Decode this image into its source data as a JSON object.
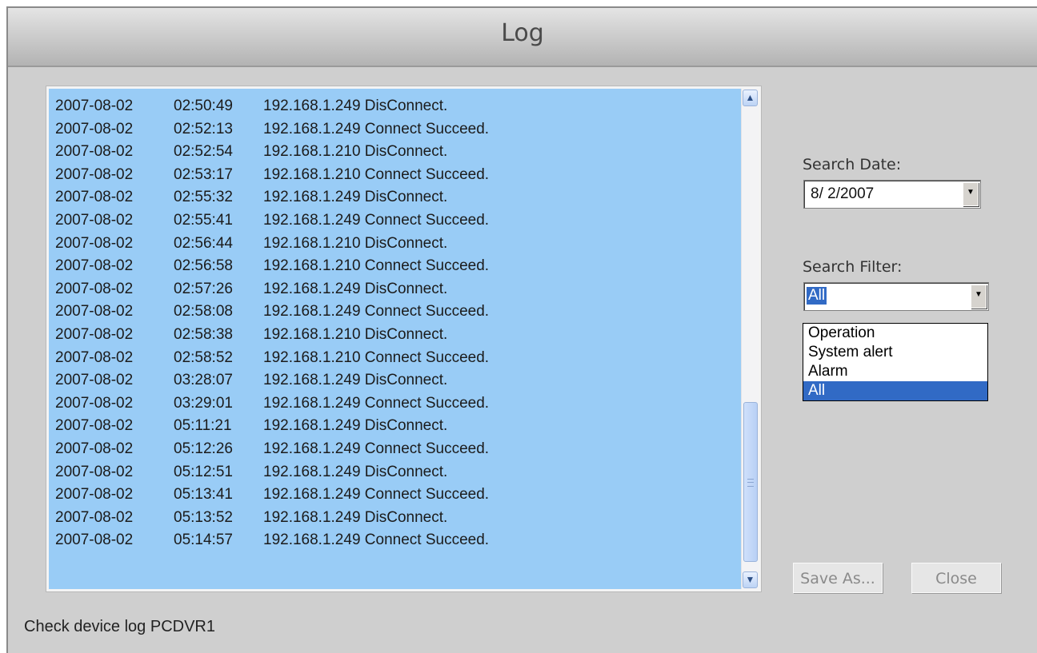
{
  "window": {
    "title": "Log"
  },
  "log": {
    "entries": [
      {
        "date": "2007-08-02",
        "time": "02:50:49",
        "message": "192.168.1.249 DisConnect."
      },
      {
        "date": "2007-08-02",
        "time": "02:52:13",
        "message": "192.168.1.249 Connect Succeed."
      },
      {
        "date": "2007-08-02",
        "time": "02:52:54",
        "message": "192.168.1.210 DisConnect."
      },
      {
        "date": "2007-08-02",
        "time": "02:53:17",
        "message": "192.168.1.210 Connect Succeed."
      },
      {
        "date": "2007-08-02",
        "time": "02:55:32",
        "message": "192.168.1.249 DisConnect."
      },
      {
        "date": "2007-08-02",
        "time": "02:55:41",
        "message": "192.168.1.249 Connect Succeed."
      },
      {
        "date": "2007-08-02",
        "time": "02:56:44",
        "message": "192.168.1.210 DisConnect."
      },
      {
        "date": "2007-08-02",
        "time": "02:56:58",
        "message": "192.168.1.210 Connect Succeed."
      },
      {
        "date": "2007-08-02",
        "time": "02:57:26",
        "message": "192.168.1.249 DisConnect."
      },
      {
        "date": "2007-08-02",
        "time": "02:58:08",
        "message": "192.168.1.249 Connect Succeed."
      },
      {
        "date": "2007-08-02",
        "time": "02:58:38",
        "message": "192.168.1.210 DisConnect."
      },
      {
        "date": "2007-08-02",
        "time": "02:58:52",
        "message": "192.168.1.210 Connect Succeed."
      },
      {
        "date": "2007-08-02",
        "time": "03:28:07",
        "message": "192.168.1.249 DisConnect."
      },
      {
        "date": "2007-08-02",
        "time": "03:29:01",
        "message": "192.168.1.249 Connect Succeed."
      },
      {
        "date": "2007-08-02",
        "time": "05:11:21",
        "message": "192.168.1.249 DisConnect."
      },
      {
        "date": "2007-08-02",
        "time": "05:12:26",
        "message": "192.168.1.249 Connect Succeed."
      },
      {
        "date": "2007-08-02",
        "time": "05:12:51",
        "message": "192.168.1.249 DisConnect."
      },
      {
        "date": "2007-08-02",
        "time": "05:13:41",
        "message": "192.168.1.249 Connect Succeed."
      },
      {
        "date": "2007-08-02",
        "time": "05:13:52",
        "message": "192.168.1.249 DisConnect."
      },
      {
        "date": "2007-08-02",
        "time": "05:14:57",
        "message": "192.168.1.249 Connect Succeed."
      }
    ]
  },
  "search_date": {
    "label": "Search Date:",
    "value": "8/ 2/2007"
  },
  "search_filter": {
    "label": "Search Filter:",
    "value": "All",
    "options": [
      "Operation",
      "System alert",
      "Alarm",
      "All"
    ],
    "highlighted": "All"
  },
  "buttons": {
    "save_as": "Save As...",
    "close": "Close"
  },
  "status": "Check device log PCDVR1"
}
